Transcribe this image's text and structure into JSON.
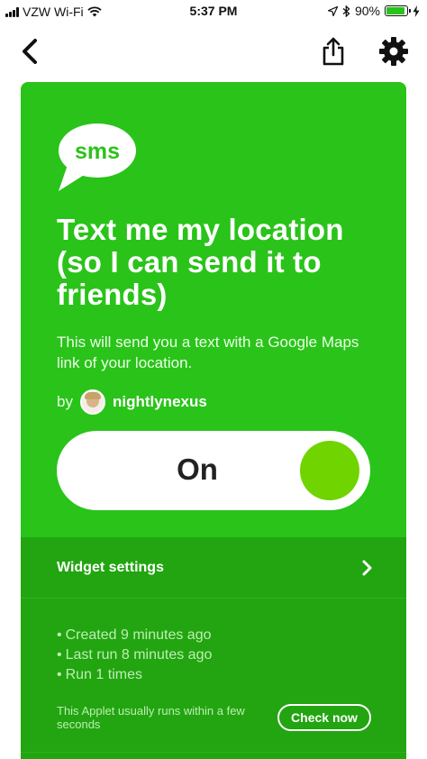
{
  "status_bar": {
    "carrier": "VZW Wi-Fi",
    "time": "5:37 PM",
    "battery_percent": "90%",
    "battery_level": 0.9,
    "icons": [
      "signal-icon",
      "wifi-icon",
      "location-arrow-icon",
      "bluetooth-icon",
      "battery-icon",
      "charging-bolt-icon"
    ]
  },
  "nav": {
    "back_icon": "chevron-left-icon",
    "share_icon": "share-icon",
    "settings_icon": "gear-icon"
  },
  "applet": {
    "service_logo": "sms",
    "title": "Text me my location (so I can send it to friends)",
    "description": "This will send you a text with a Google Maps link of your location.",
    "by_label": "by",
    "author": "nightlynexus",
    "toggle_label": "On",
    "toggle_on": true
  },
  "settings": {
    "widget_label": "Widget settings"
  },
  "info": {
    "items": [
      "Created 9 minutes ago",
      "Last run 8 minutes ago",
      "Run 1 times"
    ],
    "note": "This Applet usually runs within a few seconds",
    "check_now_label": "Check now"
  },
  "colors": {
    "card_green": "#2ac31a",
    "dark_green": "#22a510",
    "knob_green": "#6fd400"
  }
}
